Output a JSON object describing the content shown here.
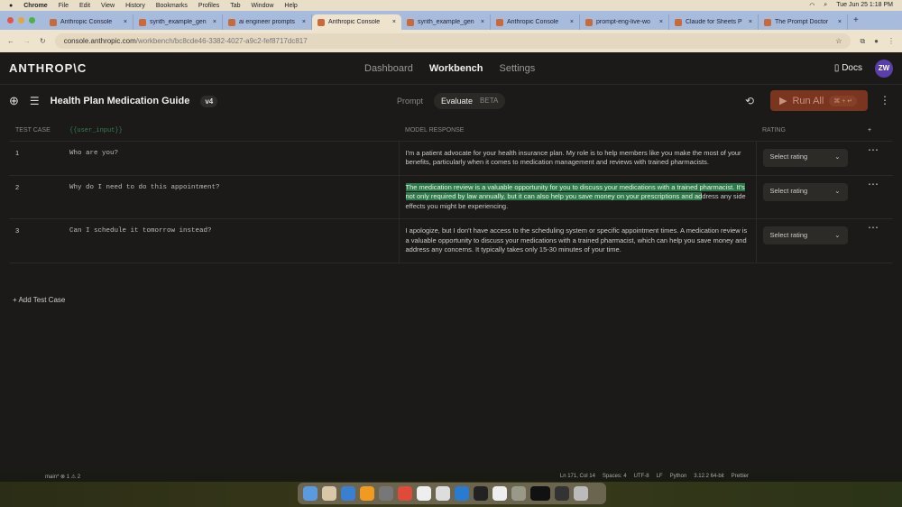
{
  "menubar": {
    "items": [
      "Chrome",
      "File",
      "Edit",
      "View",
      "History",
      "Bookmarks",
      "Profiles",
      "Tab",
      "Window",
      "Help"
    ],
    "clock": "Tue Jun 25  1:18 PM"
  },
  "tabs": [
    "Anthropic Console",
    "synth_example_gen",
    "ai engineer prompts",
    "Anthropic Console",
    "synth_example_gen",
    "Anthropic Console",
    "prompt-eng-live-wo",
    "Claude for Sheets P",
    "The Prompt Doctor"
  ],
  "active_tab": 3,
  "address": {
    "host": "console.anthropic.com",
    "path": "/workbench/bc8cde46-3382-4027-a9c2-fef8717dc817"
  },
  "nav": {
    "logo": "ANTHROP\\C",
    "links": [
      "Dashboard",
      "Workbench",
      "Settings"
    ],
    "active": "Workbench",
    "docs": "Docs",
    "avatar": "ZW"
  },
  "toolbar": {
    "title": "Health Plan Medication Guide",
    "version": "v4",
    "prompt": "Prompt",
    "evaluate": "Evaluate",
    "beta": "BETA",
    "run_all": "Run All",
    "shortcut": "⌘ + ↵"
  },
  "table": {
    "headers": {
      "test_case": "TEST CASE",
      "input": "{{user_input}}",
      "response": "MODEL RESPONSE",
      "rating": "RATING",
      "add": "+"
    },
    "rows": [
      {
        "n": "1",
        "input": "Who are you?",
        "response": "I'm a patient advocate for your health insurance plan. My role is to help members like you make the most of your benefits, particularly when it comes to medication management and reviews with trained pharmacists.",
        "rating": "Select rating"
      },
      {
        "n": "2",
        "input": "Why do I need to do this appointment?",
        "response_highlighted": "The medication review is a valuable opportunity for you to discuss your medications with a trained pharmacist. It's not only required by law annually, but it can also help you save money on your prescriptions and ad",
        "response_rest": "dress any side effects you might be experiencing.",
        "rating": "Select rating"
      },
      {
        "n": "3",
        "input": "Can I schedule it tomorrow instead?",
        "response": "I apologize, but I don't have access to the scheduling system or specific appointment times. A medication review is a valuable opportunity to discuss your medications with a trained pharmacist, which can help you save money and address any concerns. It typically takes only 15-30 minutes of your time.",
        "rating": "Select rating"
      }
    ]
  },
  "add_test_case": "+ Add Test Case",
  "statusbar": {
    "left": "main*  ⊗ 1 ⚠ 2",
    "right": [
      "Ln 171, Col 14",
      "Spaces: 4",
      "UTF-8",
      "LF",
      "Python",
      "3.12.2 64-bit",
      "Prettier"
    ]
  },
  "colors": {
    "accent": "#7a3520",
    "highlight": "#2f7a4a",
    "avatar": "#5b3fa8"
  }
}
